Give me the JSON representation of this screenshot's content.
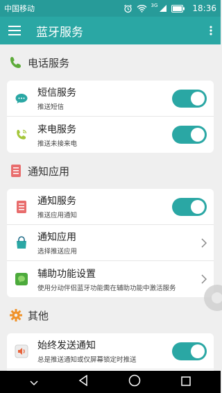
{
  "status": {
    "carrier": "中国移动",
    "network": "3G",
    "time": "18:36"
  },
  "appbar": {
    "title": "蓝牙服务"
  },
  "sections": [
    {
      "title": "电话服务",
      "icon": "phone-icon",
      "rows": [
        {
          "title": "短信服务",
          "sub": "推送短信",
          "icon": "sms-icon",
          "control": "toggle",
          "on": true
        },
        {
          "title": "来电服务",
          "sub": "推送未接来电",
          "icon": "call-icon",
          "control": "toggle",
          "on": true
        }
      ]
    },
    {
      "title": "通知应用",
      "icon": "notification-icon",
      "rows": [
        {
          "title": "通知服务",
          "sub": "推送应用通知",
          "icon": "notification-service-icon",
          "control": "toggle",
          "on": true
        },
        {
          "title": "通知应用",
          "sub": "选择推送应用",
          "icon": "bag-icon",
          "control": "chevron"
        },
        {
          "title": "辅助功能设置",
          "sub": "使用分动伴侣蓝牙功能需在辅助功能中激活服务",
          "icon": "accessibility-icon",
          "control": "chevron"
        }
      ]
    },
    {
      "title": "其他",
      "icon": "gear-icon",
      "rows": [
        {
          "title": "始终发送通知",
          "sub": "总是推送通知或仅屏幕锁定时推送",
          "icon": "volume-icon",
          "control": "toggle",
          "on": true
        }
      ]
    }
  ],
  "colors": {
    "accent": "#2aa7a4",
    "statusbar": "#279b99"
  }
}
